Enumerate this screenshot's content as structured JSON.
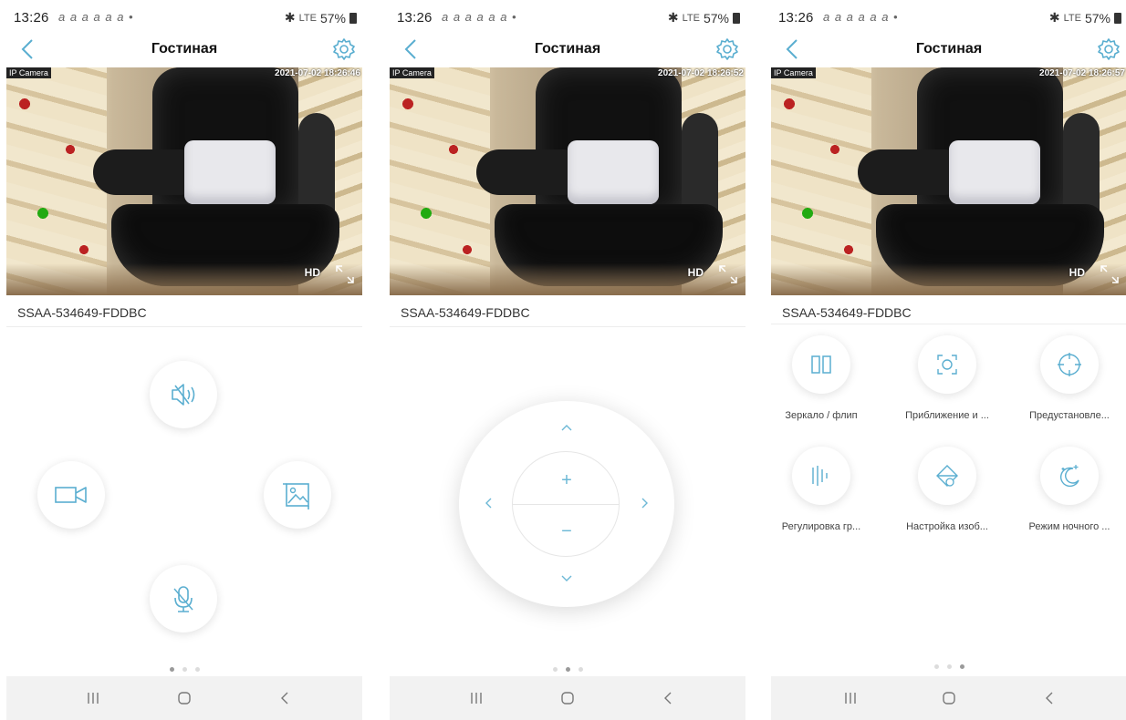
{
  "status_bar": {
    "time": "13:26",
    "notif": "a a a a a a  •",
    "signal": "LTE",
    "battery": "57%"
  },
  "app": {
    "title": "Гостиная",
    "device_id": "SSAA-534649-FDDBC"
  },
  "video": {
    "camera_label": "IP Camera",
    "timestamps": [
      "2021-07-02 18:26:46",
      "2021-07-02 18:26:52",
      "2021-07-02 18:26:57"
    ],
    "hd_label": "HD"
  },
  "ptz": {
    "zoom_in": "+",
    "zoom_out": "−"
  },
  "features": [
    {
      "label": "Зеркало / флип",
      "icon": "mirror-flip-icon"
    },
    {
      "label": "Приближение и ...",
      "icon": "zoom-focus-icon"
    },
    {
      "label": "Предустановле...",
      "icon": "preset-crosshair-icon"
    },
    {
      "label": "Регулировка гр...",
      "icon": "volume-bars-icon"
    },
    {
      "label": "Настройка изоб...",
      "icon": "image-adjust-icon"
    },
    {
      "label": "Режим ночного ...",
      "icon": "night-mode-icon"
    }
  ],
  "pager": {
    "pages": 3
  },
  "colors": {
    "accent": "#5aaed0",
    "nav_bg": "#f2f2f2"
  }
}
